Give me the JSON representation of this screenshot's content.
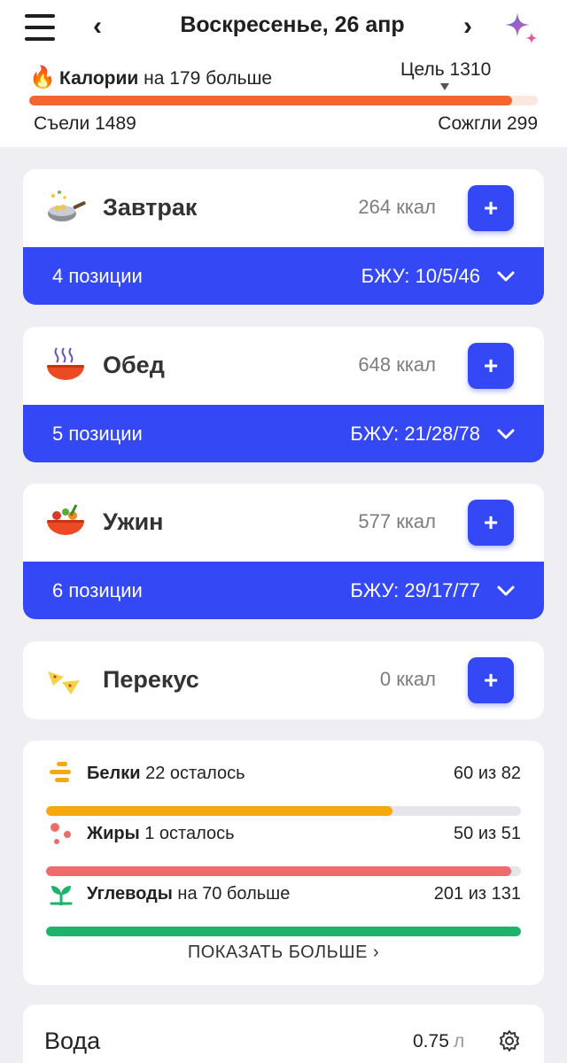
{
  "header": {
    "date_title": "Воскресенье, 26 апр",
    "prev_arrow": "‹",
    "next_arrow": "›"
  },
  "calories": {
    "label_bold": "Калории",
    "label_rest": "на 179 больше",
    "goal": "Цель 1310",
    "eaten": "Съели 1489",
    "burned": "Сожгли 299",
    "progress_fraction": 0.95,
    "bar_color": "#f2662f"
  },
  "meals": [
    {
      "name": "Завтрак",
      "kcal": "264 ккал",
      "count": "4 позиции",
      "macros": "БЖУ: 10/5/46",
      "icon": "wok-icon",
      "add": "+"
    },
    {
      "name": "Обед",
      "kcal": "648 ккал",
      "count": "5 позиции",
      "macros": "БЖУ: 21/28/78",
      "icon": "soup-bowl-icon",
      "add": "+"
    },
    {
      "name": "Ужин",
      "kcal": "577 ккал",
      "count": "6 позиции",
      "macros": "БЖУ: 29/17/77",
      "icon": "salad-bowl-icon",
      "add": "+"
    },
    {
      "name": "Перекус",
      "kcal": "0 ккал",
      "icon": "nachos-icon",
      "add": "+"
    }
  ],
  "macros": {
    "protein": {
      "label_bold": "Белки",
      "label_rest": "22 осталось",
      "value": "60 из 82",
      "fraction": 0.73,
      "color": "#f5a90f"
    },
    "fat": {
      "label_bold": "Жиры",
      "label_rest": "1 осталось",
      "value": "50 из 51",
      "fraction": 0.98,
      "color": "#ee6b6b"
    },
    "carbs": {
      "label_bold": "Углеводы",
      "label_rest": "на 70 больше",
      "value": "201 из 131",
      "fraction": 1.0,
      "color": "#1fb26b"
    },
    "show_more": "ПОКАЗАТЬ БОЛЬШЕ ›"
  },
  "water": {
    "title": "Вода",
    "value": "0.75",
    "unit": "л"
  },
  "colors": {
    "accent": "#3548f5",
    "background": "#efeff3"
  }
}
